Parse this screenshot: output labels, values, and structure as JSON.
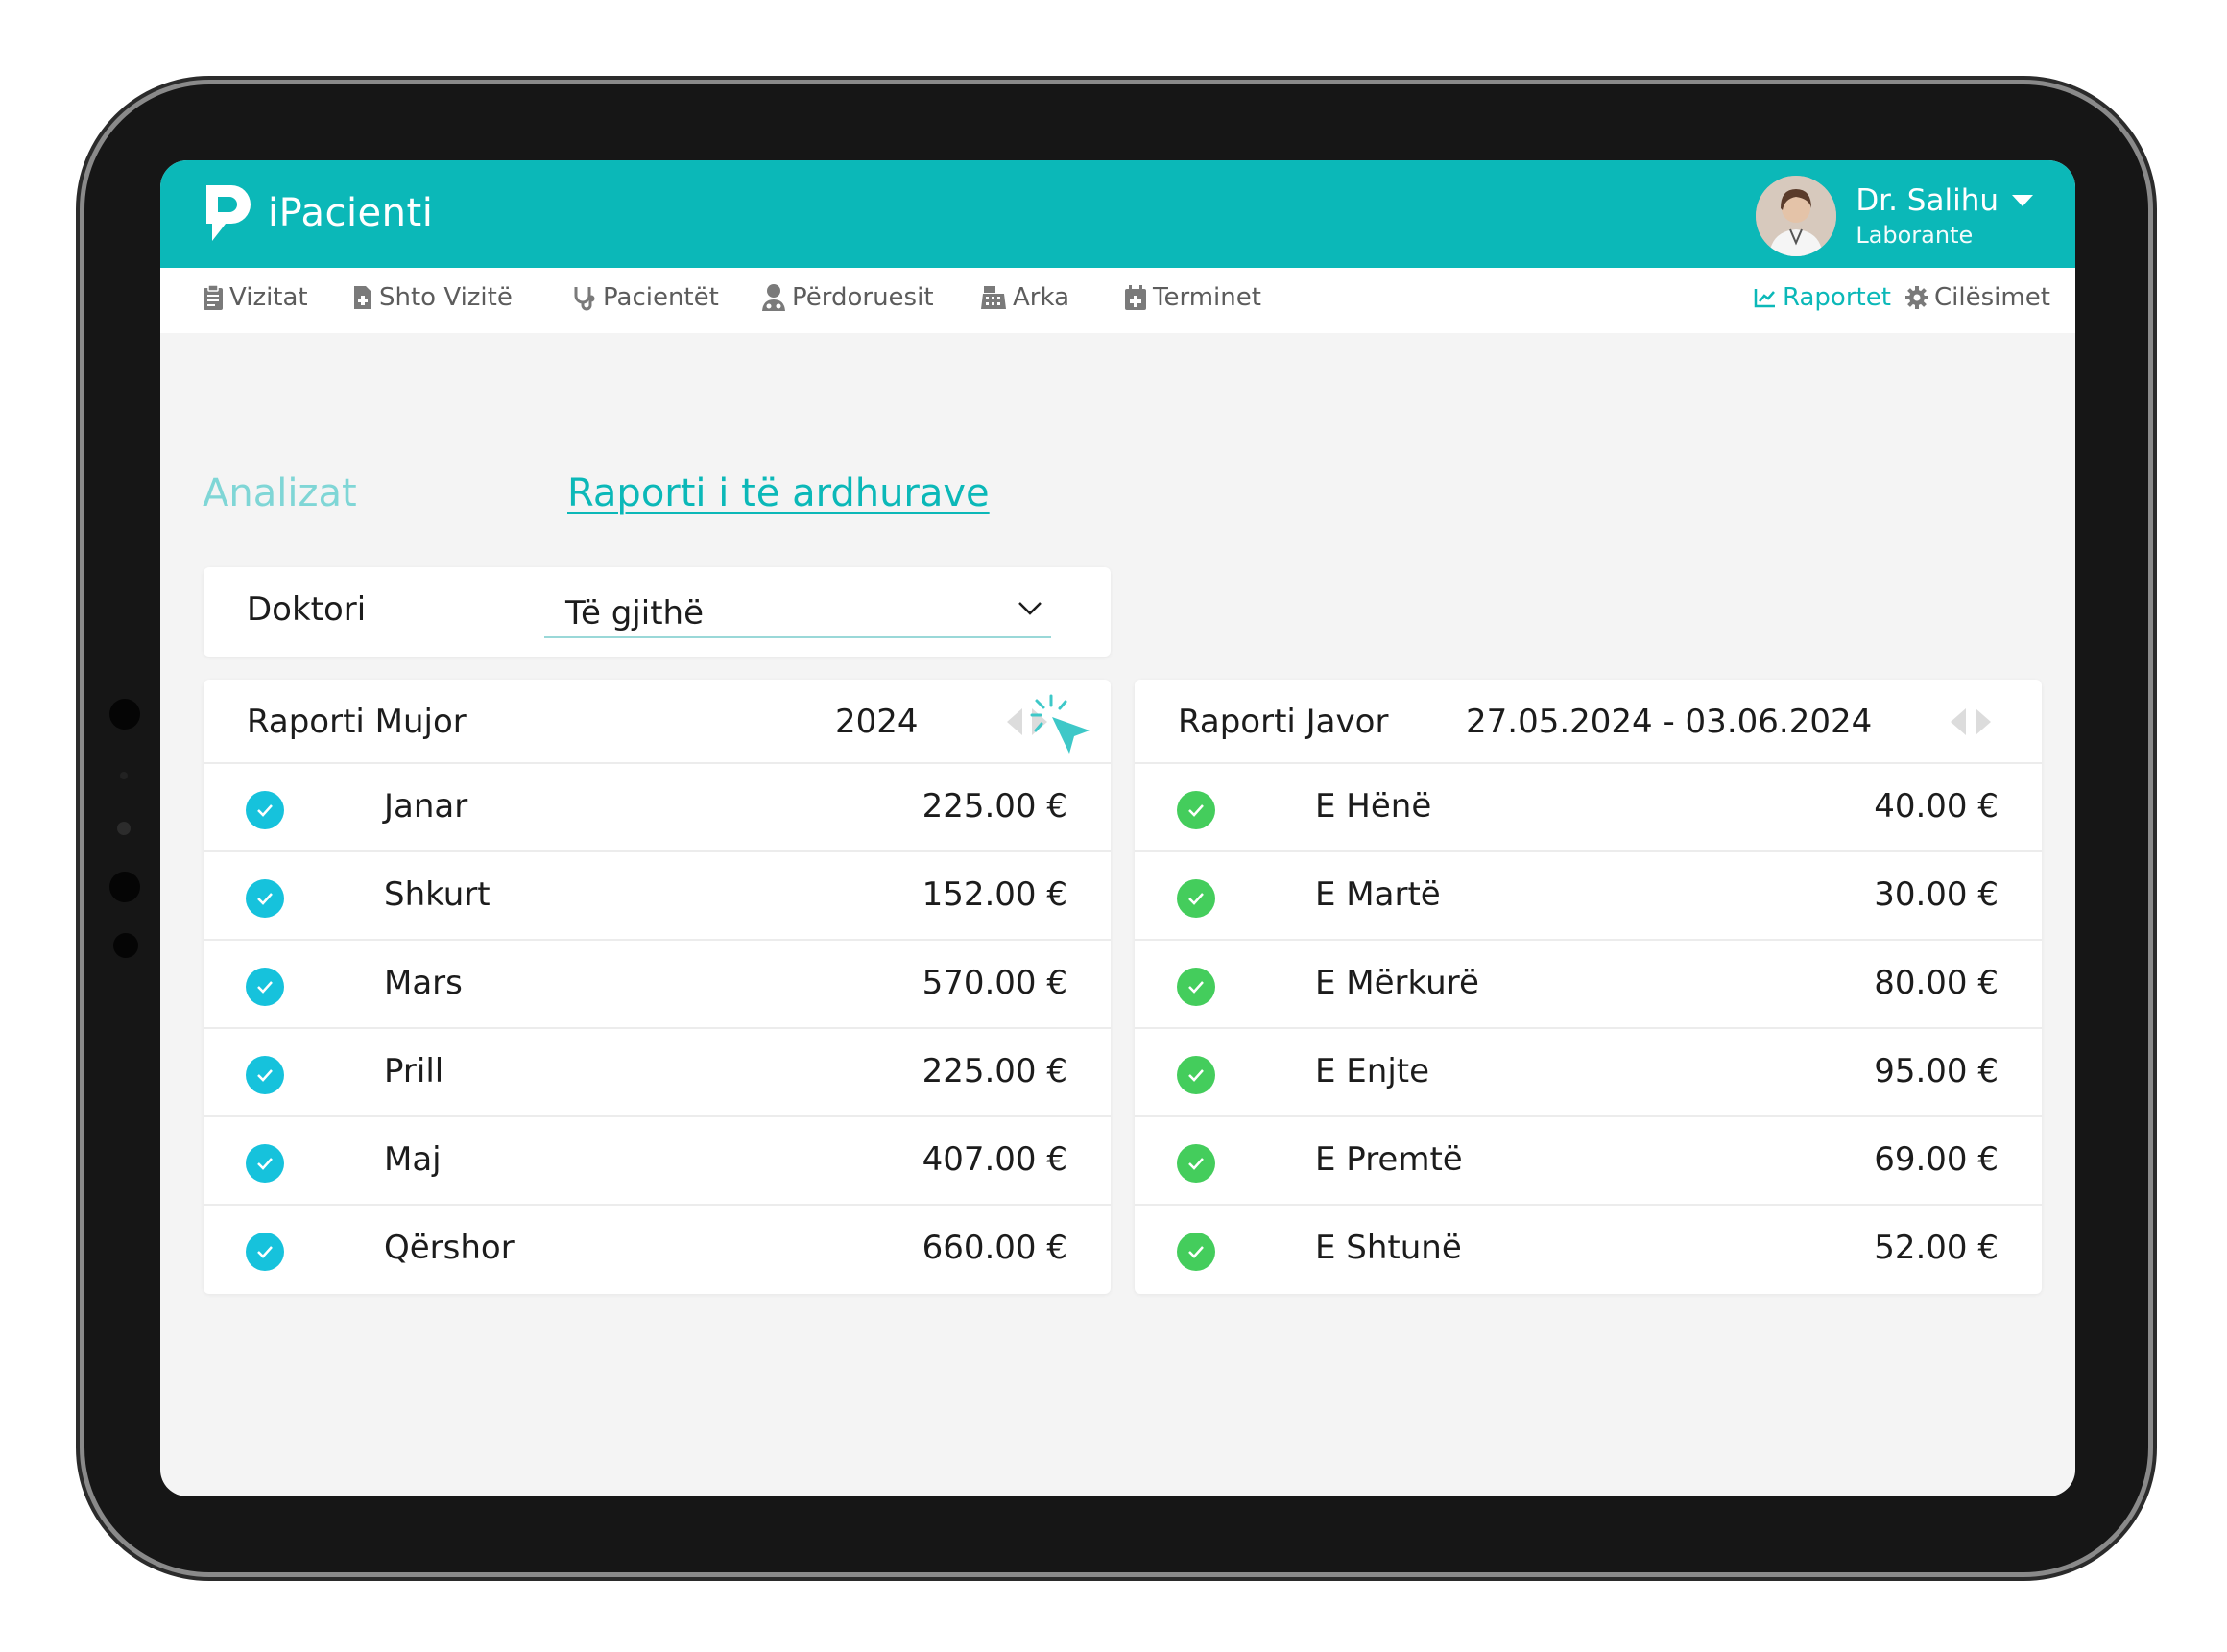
{
  "app": {
    "name": "iPacienti",
    "brand_color": "#0bb8b8"
  },
  "user": {
    "name": "Dr. Salihu",
    "role": "Laborante"
  },
  "nav": {
    "items": [
      {
        "label": "Vizitat",
        "icon": "clipboard-icon"
      },
      {
        "label": "Shto Vizitë",
        "icon": "add-document-icon"
      },
      {
        "label": "Pacientët",
        "icon": "stethoscope-icon"
      },
      {
        "label": "Përdoruesit",
        "icon": "user-doctor-icon"
      },
      {
        "label": "Arka",
        "icon": "cash-register-icon"
      },
      {
        "label": "Terminet",
        "icon": "calendar-plus-icon"
      }
    ],
    "right_items": [
      {
        "label": "Raportet",
        "icon": "chart-line-icon",
        "active": true
      },
      {
        "label": "Cilësimet",
        "icon": "gear-icon",
        "active": false
      }
    ]
  },
  "tabs": {
    "analizat": "Analizat",
    "raporti": "Raporti i të ardhurave"
  },
  "filter": {
    "label": "Doktori",
    "selected": "Të gjithë"
  },
  "monthly_report": {
    "title": "Raporti Mujor",
    "year": "2024",
    "rows": [
      {
        "label": "Janar",
        "value": "225.00 €"
      },
      {
        "label": "Shkurt",
        "value": "152.00 €"
      },
      {
        "label": "Mars",
        "value": "570.00 €"
      },
      {
        "label": "Prill",
        "value": "225.00 €"
      },
      {
        "label": "Maj",
        "value": "407.00 €"
      },
      {
        "label": "Qërshor",
        "value": "660.00 €"
      }
    ]
  },
  "weekly_report": {
    "title": "Raporti Javor",
    "range": "27.05.2024 - 03.06.2024",
    "rows": [
      {
        "label": "E Hënë",
        "value": "40.00 €"
      },
      {
        "label": "E Martë",
        "value": "30.00 €"
      },
      {
        "label": "E Mërkurë",
        "value": "80.00 €"
      },
      {
        "label": "E Enjte",
        "value": "95.00 €"
      },
      {
        "label": "E Premtë",
        "value": "69.00 €"
      },
      {
        "label": "E Shtunë",
        "value": "52.00 €"
      }
    ]
  },
  "colors": {
    "check_monthly": "#16c2dc",
    "check_weekly": "#44cd5c"
  }
}
